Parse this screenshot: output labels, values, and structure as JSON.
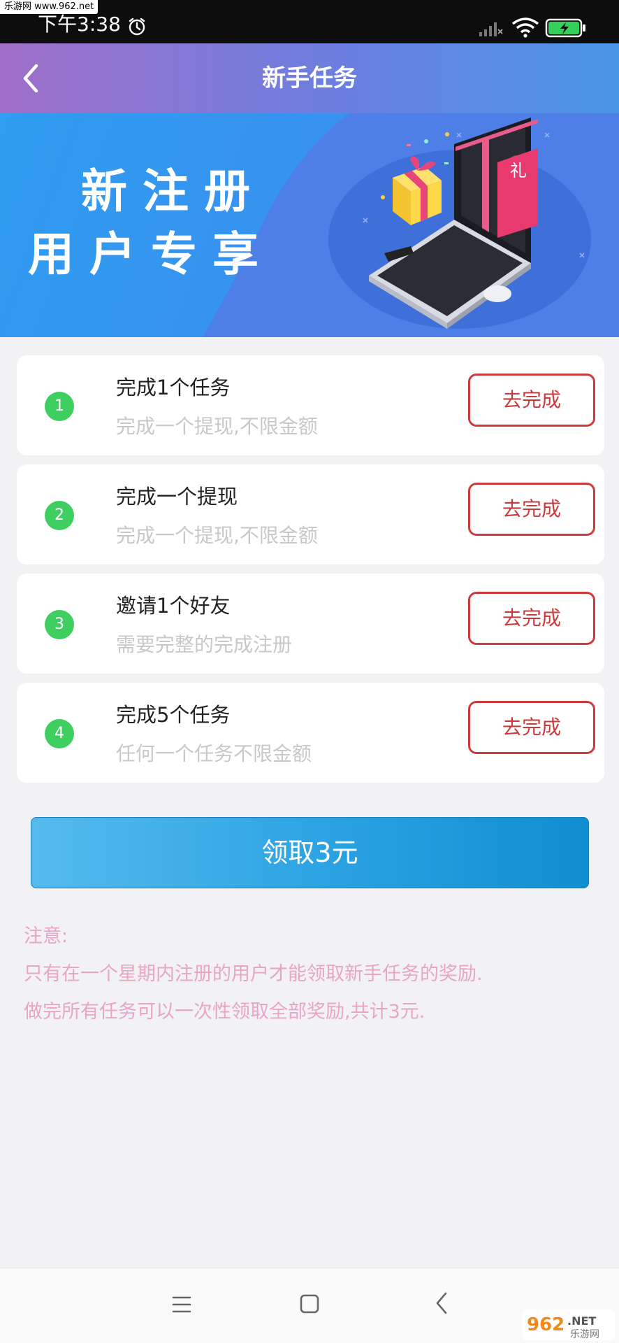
{
  "watermark_top": "乐游网 www.962.net",
  "status_bar": {
    "time": "下午3:38"
  },
  "header": {
    "title": "新手任务"
  },
  "banner": {
    "line1": "新注册",
    "line2": "用户专享",
    "gift_label": "礼"
  },
  "tasks": [
    {
      "number": "1",
      "title": "完成1个任务",
      "description": "完成一个提现,不限金额",
      "button": "去完成"
    },
    {
      "number": "2",
      "title": "完成一个提现",
      "description": "完成一个提现,不限金额",
      "button": "去完成"
    },
    {
      "number": "3",
      "title": "邀请1个好友",
      "description": "需要完整的完成注册",
      "button": "去完成"
    },
    {
      "number": "4",
      "title": "完成5个任务",
      "description": "任何一个任务不限金额",
      "button": "去完成"
    }
  ],
  "claim_button": "领取3元",
  "notes": {
    "heading": "注意:",
    "line1": "只有在一个星期内注册的用户才能领取新手任务的奖励.",
    "line2": "做完所有任务可以一次性领取全部奖励,共计3元."
  },
  "watermark_bottom": {
    "brand": "962",
    "suffix": ".NET",
    "sub": "乐游网"
  },
  "colors": {
    "task_number": "#3fcf61",
    "task_button": "#cc3b3b",
    "note_text": "#e8a6c6"
  }
}
